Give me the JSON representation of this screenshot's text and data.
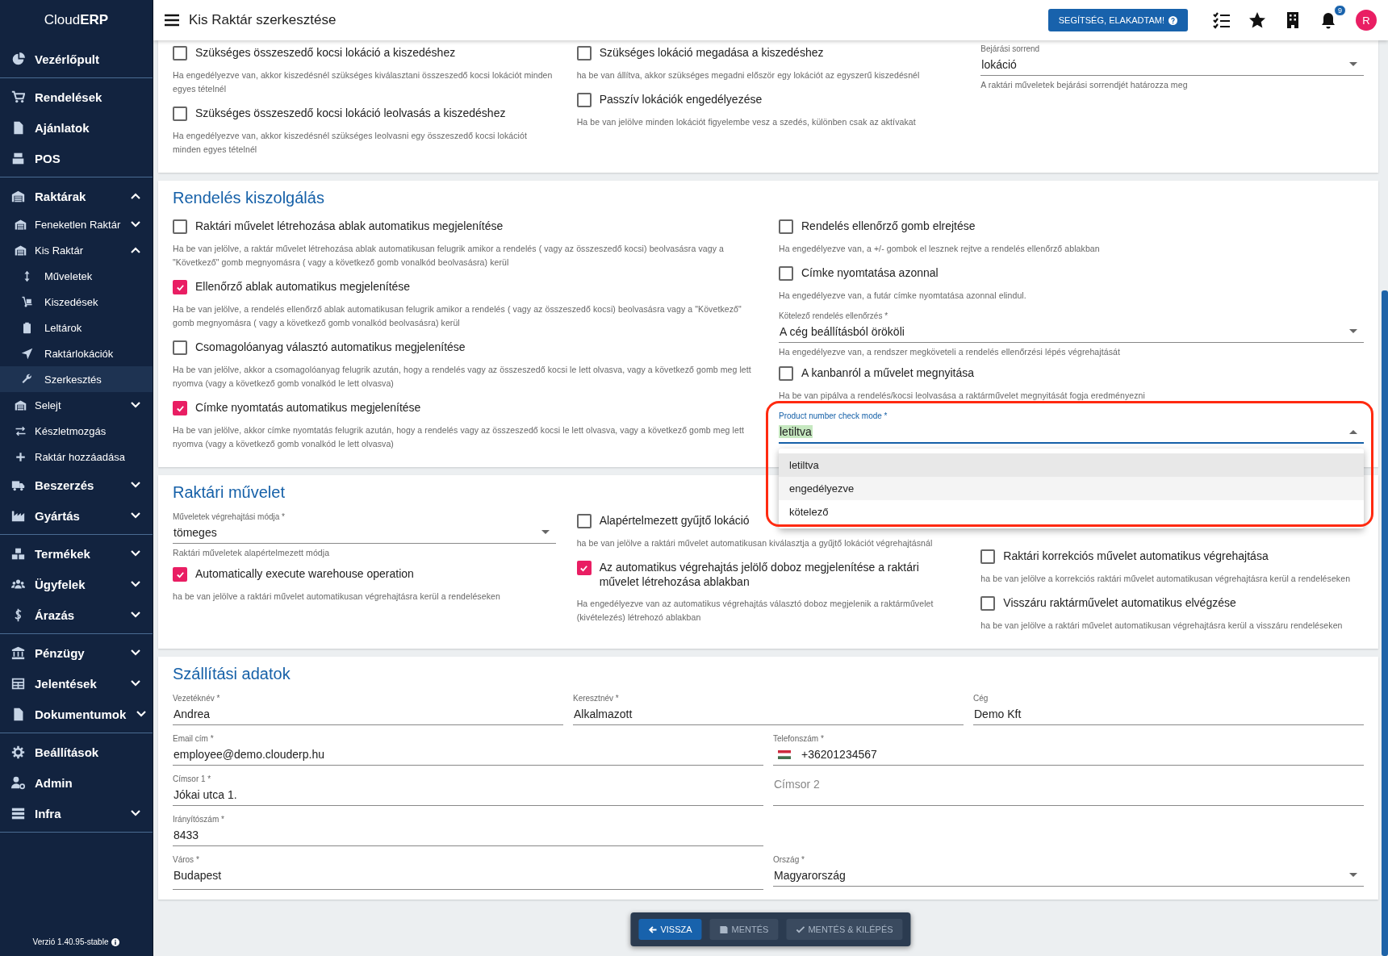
{
  "sidebar": {
    "brand": "Cloud**ERP**",
    "groups": [
      [
        {
          "label": "Vezérlőpult"
        }
      ],
      [
        {
          "label": "Rendelések"
        },
        {
          "label": "Ajánlatok"
        },
        {
          "label": "POS"
        }
      ],
      [
        {
          "label": "Raktárak",
          "expanded": true,
          "children": [
            {
              "label": "Feneketlen Raktár",
              "expanded": false
            },
            {
              "label": "Kis Raktár",
              "expanded": true,
              "children": [
                {
                  "label": "Műveletek",
                  "selected": false
                },
                {
                  "label": "Kiszedések",
                  "selected": false
                },
                {
                  "label": "Leltárok",
                  "selected": false
                },
                {
                  "label": "Raktárlokációk",
                  "selected": false
                },
                {
                  "label": "Szerkesztés",
                  "selected": true
                }
              ]
            },
            {
              "label": "Selejt",
              "expanded": false
            },
            {
              "label": "Készletmozgás"
            },
            {
              "label": "Raktár hozzáadása"
            }
          ]
        },
        {
          "label": "Beszerzés",
          "expanded": false
        },
        {
          "label": "Gyártás",
          "expanded": false
        }
      ],
      [
        {
          "label": "Termékek",
          "expanded": false
        },
        {
          "label": "Ügyfelek",
          "expanded": false
        },
        {
          "label": "Árazás",
          "expanded": false
        }
      ],
      [
        {
          "label": "Pénzügy",
          "expanded": false
        },
        {
          "label": "Jelentések",
          "expanded": false
        },
        {
          "label": "Dokumentumok",
          "expanded": false
        }
      ],
      [
        {
          "label": "Beállítások"
        },
        {
          "label": "Admin"
        },
        {
          "label": "Infra",
          "expanded": false
        }
      ]
    ],
    "version": "Verzió 1.40.95-stable"
  },
  "header": {
    "title": "Kis Raktár szerkesztése",
    "help_button": "SEGÍTSÉG, ELAKADTAM!",
    "notification_count": "9",
    "avatar": "R"
  },
  "sections": [
    {
      "columns": [
        [
          {
            "kind": "checkbox",
            "label": "Szükséges összeszedő kocsi lokáció a kiszedéshez",
            "checked": false,
            "help": "Ha engedélyezve van, akkor kiszedésnél szükséges kiválasztani összeszedő kocsi lokációt minden egyes tételnél"
          },
          {
            "kind": "checkbox",
            "label": "Szükséges összeszedő kocsi lokáció leolvasás a kiszedéshez",
            "checked": false,
            "help": "Ha engedélyezve van, akkor kiszedésnél szükséges leolvasni egy összeszedő kocsi lokációt minden egyes tételnél"
          }
        ],
        [
          {
            "kind": "checkbox",
            "label": "Szükséges lokáció megadása a kiszedéshez",
            "checked": false,
            "help": "ha be van állítva, akkor szükséges megadni először egy lokációt az egyszerű kiszedésnél"
          },
          {
            "kind": "checkbox",
            "label": "Passzív lokációk engedélyezése",
            "checked": false,
            "help": "Ha be van jelölve minden lokációt figyelembe vesz a szedés, különben csak az aktívakat"
          }
        ],
        [
          {
            "kind": "select",
            "label": "Bejárási sorrend",
            "value": "lokáció",
            "open": false,
            "help": "A raktári műveletek bejárási sorrendjét határozza meg"
          }
        ]
      ]
    },
    {
      "title": "Rendelés kiszolgálás",
      "columns": [
        [
          {
            "kind": "checkbox",
            "label": "Raktári művelet létrehozása ablak automatikus megjelenítése",
            "checked": false,
            "help": "Ha be van jelölve, a raktár művelet létrehozása ablak automatikusan felugrik amikor a rendelés ( vagy az összeszedő kocsi) beolvasásra vagy a \"Következő\" gomb megnyomásra ( vagy a következő gomb vonalkód beolvasásra) kerül"
          },
          {
            "kind": "checkbox",
            "label": "Ellenőrző ablak automatikus megjelenítése",
            "checked": true,
            "help": "Ha be van jelölve, a rendelés ellenőrző ablak automatikusan felugrik amikor a rendelés ( vagy az összeszedő kocsi) beolvasásra vagy a \"Következő\" gomb megnyomásra ( vagy a következő gomb vonalkód beolvasásra) kerül"
          },
          {
            "kind": "checkbox",
            "label": "Csomagolóanyag választó automatikus megjelenítése",
            "checked": false,
            "help": "Ha be van jelölve, akkor a csomagolóanyag felugrik azután, hogy a rendelés vagy az összeszedő kocsi le lett olvasva, vagy a következő gomb meg lett nyomva (vagy a következő gomb vonalkód le lett olvasva)"
          },
          {
            "kind": "checkbox",
            "label": "Címke nyomtatás automatikus megjelenítése",
            "checked": true,
            "help": "Ha be van jelölve, akkor címke nyomtatás felugrik azután, hogy a rendelés vagy az összeszedő kocsi le lett olvasva, vagy a következő gomb meg lett nyomva (vagy a következő gomb vonalkód le lett olvasva)"
          }
        ],
        [
          {
            "kind": "checkbox",
            "label": "Rendelés ellenőrző gomb elrejtése",
            "checked": false,
            "help": "Ha engedélyezve van, a +/- gombok el lesznek rejtve a rendelés ellenőrző ablakban"
          },
          {
            "kind": "checkbox",
            "label": "Címke nyomtatása azonnal",
            "checked": false,
            "help": "Ha engedélyezve van, a futár címke nyomtatása azonnal elindul."
          },
          {
            "kind": "select",
            "label": "Kötelező rendelés ellenőrzés *",
            "value": "A cég beállításból örököli",
            "open": false,
            "help": "Ha engedélyezve van, a rendszer megköveteli a rendelés ellenőrzési lépés végrehajtását"
          },
          {
            "kind": "checkbox",
            "label": "A kanbanról a művelet megnyitása",
            "checked": false,
            "help": "Ha be van pipálva a rendelés/kocsi leolvasása a raktárművelet megnyitását fogja eredményezni"
          },
          {
            "kind": "select",
            "label": "Product number check mode *",
            "value": "letiltva",
            "value_highlighted": true,
            "open": true,
            "annotated": true,
            "options": [
              {
                "label": "letiltva",
                "selected": true,
                "hovered": false
              },
              {
                "label": "engedélyezve",
                "selected": false,
                "hovered": true
              },
              {
                "label": "kötelező",
                "selected": false,
                "hovered": false
              }
            ]
          }
        ]
      ]
    },
    {
      "title": "Raktári művelet",
      "columns": [
        [
          {
            "kind": "select",
            "label": "Műveletek végrehajtási módja *",
            "value": "tömeges",
            "open": false,
            "help": "Raktári műveletek alapértelmezett módja"
          },
          {
            "kind": "checkbox",
            "label": "Automatically execute warehouse operation",
            "checked": true,
            "help": "ha be van jelölve a raktári művelet automatikusan végrehajtásra kerül a rendeléseken"
          }
        ],
        [
          {
            "kind": "checkbox",
            "label": "Alapértelmezett gyűjtő lokáció",
            "checked": false,
            "help": "ha be van jelölve a raktári művelet automatikusan kiválasztja a gyűjtő lokációt végrehajtásnál"
          },
          {
            "kind": "checkbox",
            "label": "Az automatikus végrehajtás jelölő doboz megjelenítése a raktári művelet létrehozása ablakban",
            "checked": true,
            "help": "Ha engedélyezve van az automatikus végrehajtás választó doboz megjelenik a raktárművelet (kivételezés) létrehozó ablakban"
          }
        ],
        [
          {
            "kind": "checkbox",
            "label": "Raktári korrekciós művelet automatikus végrehajtása",
            "checked": false,
            "help": "ha be van jelölve a korrekciós raktári művelet automatikusan végrehajtásra kerül a rendeléseken"
          },
          {
            "kind": "checkbox",
            "label": "Visszáru raktárművelet automatikus elvégzése",
            "checked": false,
            "help": "ha be van jelölve a raktári művelet automatikusan végrehajtásra kerül a visszáru rendeléseken"
          }
        ]
      ]
    },
    {
      "title": "Szállítási adatok",
      "rows": [
        [
          {
            "kind": "text",
            "label": "Vezetéknév *",
            "value": "Andrea"
          },
          {
            "kind": "text",
            "label": "Keresztnév *",
            "value": "Alkalmazott"
          },
          {
            "kind": "text",
            "label": "Cég",
            "value": "Demo Kft"
          }
        ],
        [
          {
            "kind": "text",
            "label": "Email cím *",
            "value": "employee@demo.clouderp.hu"
          },
          {
            "kind": "phone",
            "label": "Telefonszám *",
            "value": "+36201234567"
          }
        ],
        [
          {
            "kind": "text",
            "label": "Címsor 1 *",
            "value": "Jókai utca 1."
          },
          {
            "kind": "text",
            "placeholder": "Címsor 2"
          }
        ],
        [
          {
            "kind": "text",
            "label": "Irányítószám *",
            "value": "8433"
          }
        ],
        [
          {
            "kind": "text",
            "label": "Város *",
            "value": "Budapest"
          },
          {
            "kind": "select",
            "label": "Ország *",
            "value": "Magyarország",
            "open": false
          }
        ]
      ]
    }
  ],
  "actions": [
    {
      "label": "VISSZA",
      "disabled": false
    },
    {
      "label": "MENTÉS",
      "disabled": true
    },
    {
      "label": "MENTÉS & KILÉPÉS",
      "disabled": true
    }
  ]
}
